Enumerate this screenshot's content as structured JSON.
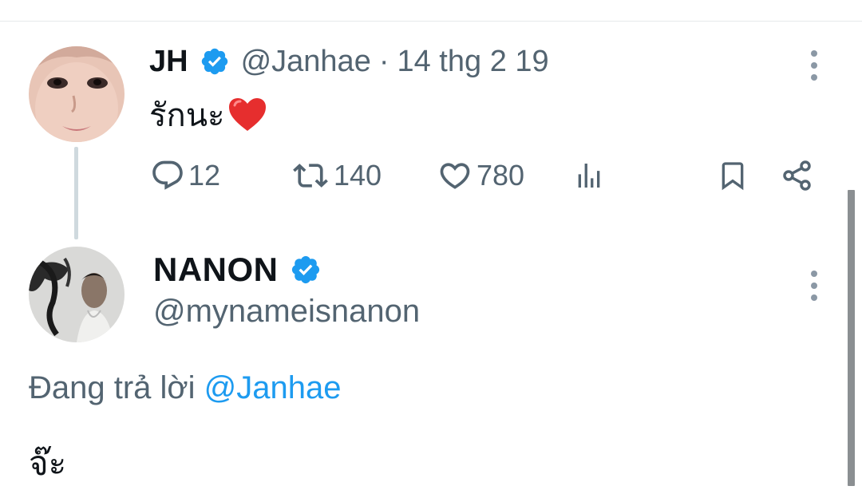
{
  "tweet": {
    "author_name": "JH",
    "handle": "@Janhae",
    "separator": "·",
    "date": "14 thg 2 19",
    "text": "รักนะ",
    "text_emoji": "heart-emoji",
    "actions": {
      "reply_count": "12",
      "retweet_count": "140",
      "like_count": "780"
    }
  },
  "reply": {
    "author_name": "NANON",
    "handle": "@mynameisnanon",
    "replying_prefix": "Đang trả lời",
    "replying_to": "@Janhae",
    "text": "จ๊ะ"
  },
  "colors": {
    "verified": "#1d9bf0",
    "secondary_text": "#536471",
    "mention": "#1d9bf0",
    "heart": "#e0245e"
  },
  "icons": [
    "verified-badge-icon",
    "reply-icon",
    "retweet-icon",
    "like-icon",
    "views-icon",
    "bookmark-icon",
    "share-icon",
    "more-options-icon"
  ]
}
